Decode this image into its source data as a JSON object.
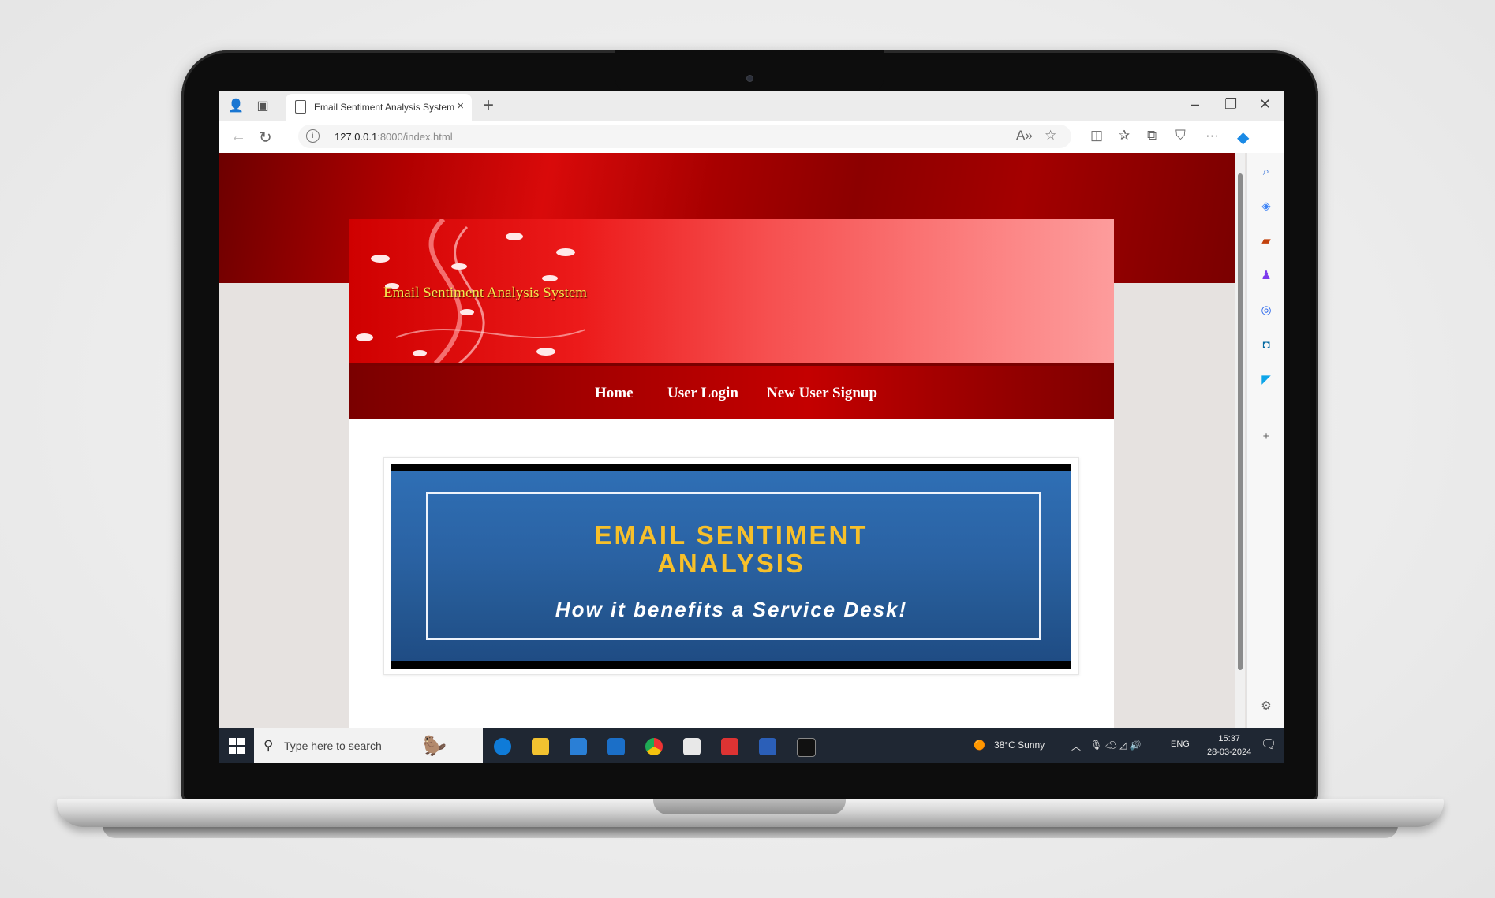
{
  "browser": {
    "tab_title": "Email Sentiment Analysis System",
    "tab_close": "×",
    "new_tab": "+",
    "url_host": "127.0.0.1",
    "url_path": ":8000/index.html",
    "window_controls": {
      "minimize": "–",
      "restore": "❐",
      "close": "✕"
    }
  },
  "site": {
    "title": "Email Sentiment Analysis System",
    "nav": [
      "Home",
      "User Login",
      "New User Signup"
    ],
    "hero_line1": "EMAIL SENTIMENT",
    "hero_line2": "ANALYSIS",
    "hero_subtitle": "How it benefits a Service Desk!"
  },
  "taskbar": {
    "search_placeholder": "Type here to search",
    "weather": "38°C  Sunny",
    "language": "ENG",
    "time": "15:37",
    "date": "28-03-2024"
  },
  "colors": {
    "brand_red": "#b00000",
    "title_yellow": "#f4e44e",
    "hero_yellow": "#f7c02a",
    "hero_blue": "#2a62a3"
  }
}
